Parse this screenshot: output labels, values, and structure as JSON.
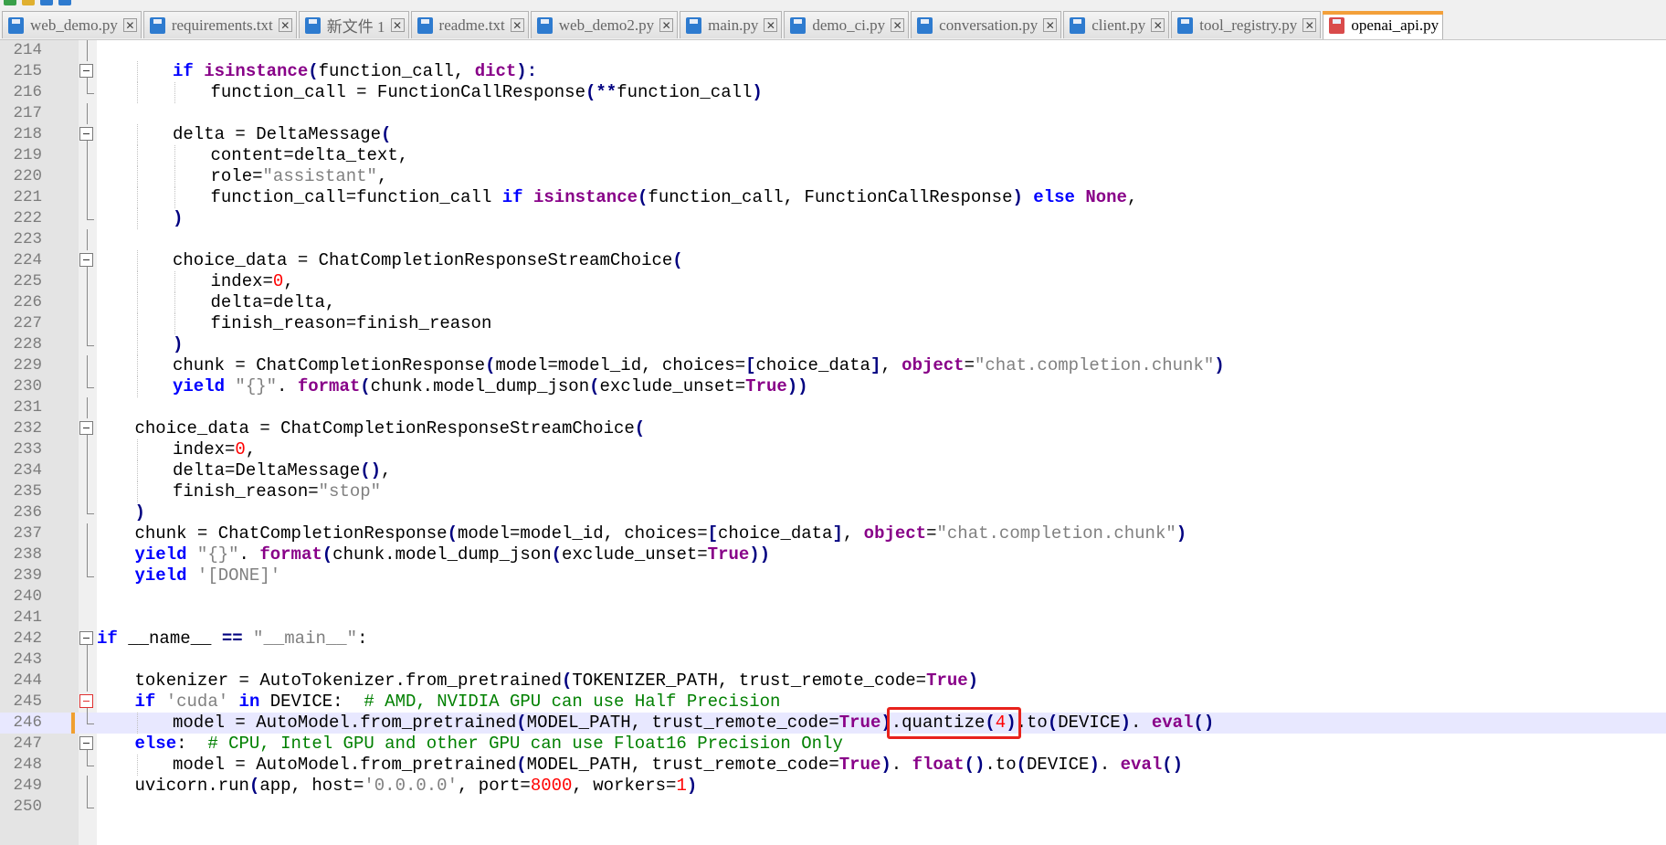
{
  "tabs": [
    {
      "label": "web_demo.py",
      "active": false,
      "unsaved": false
    },
    {
      "label": "requirements.txt",
      "active": false,
      "unsaved": false
    },
    {
      "label": "新文件 1",
      "active": false,
      "unsaved": false
    },
    {
      "label": "readme.txt",
      "active": false,
      "unsaved": false
    },
    {
      "label": "web_demo2.py",
      "active": false,
      "unsaved": false
    },
    {
      "label": "main.py",
      "active": false,
      "unsaved": false
    },
    {
      "label": "demo_ci.py",
      "active": false,
      "unsaved": false
    },
    {
      "label": "conversation.py",
      "active": false,
      "unsaved": false
    },
    {
      "label": "client.py",
      "active": false,
      "unsaved": false
    },
    {
      "label": "tool_registry.py",
      "active": false,
      "unsaved": false
    },
    {
      "label": "openai_api.py",
      "active": true,
      "unsaved": true
    }
  ],
  "tab_close_glyph": "✕",
  "colors": {
    "keyword": "#0000ff",
    "builtin": "#880088",
    "string": "#808080",
    "number": "#ff0000",
    "comment": "#008000",
    "current_line": "#e8e8ff",
    "highlight_box": "#e8221c",
    "active_tab_accent": "#f3a03a"
  },
  "editor": {
    "current_line": 246,
    "highlight": {
      "line": 246,
      "text": ".quantize(4)"
    },
    "lines": [
      {
        "n": 214,
        "indent": 0,
        "fold": "line",
        "tokens": []
      },
      {
        "n": 215,
        "indent": 2,
        "fold": "box",
        "tokens": [
          [
            "kw",
            "if "
          ],
          [
            "bi",
            "isinstance"
          ],
          [
            "op",
            "("
          ],
          [
            "",
            "function_call, "
          ],
          [
            "bi",
            "dict"
          ],
          [
            "op",
            "):"
          ]
        ]
      },
      {
        "n": 216,
        "indent": 3,
        "fold": "end",
        "tokens": [
          [
            "",
            "function_call = FunctionCallResponse"
          ],
          [
            "op",
            "(**"
          ],
          [
            "",
            "function_call"
          ],
          [
            "op",
            ")"
          ]
        ]
      },
      {
        "n": 217,
        "indent": 0,
        "fold": "line",
        "tokens": []
      },
      {
        "n": 218,
        "indent": 2,
        "fold": "box",
        "tokens": [
          [
            "",
            "delta = DeltaMessage"
          ],
          [
            "op",
            "("
          ]
        ]
      },
      {
        "n": 219,
        "indent": 3,
        "fold": "line",
        "tokens": [
          [
            "",
            "content=delta_text,"
          ]
        ]
      },
      {
        "n": 220,
        "indent": 3,
        "fold": "line",
        "tokens": [
          [
            "",
            "role="
          ],
          [
            "st",
            "\"assistant\""
          ],
          [
            "",
            ","
          ]
        ]
      },
      {
        "n": 221,
        "indent": 3,
        "fold": "line",
        "tokens": [
          [
            "",
            "function_call=function_call "
          ],
          [
            "kw",
            "if "
          ],
          [
            "bi",
            "isinstance"
          ],
          [
            "op",
            "("
          ],
          [
            "",
            "function_call, FunctionCallResponse"
          ],
          [
            "op",
            ")"
          ],
          [
            "kw",
            " else "
          ],
          [
            "bi",
            "None"
          ],
          [
            "",
            ","
          ]
        ]
      },
      {
        "n": 222,
        "indent": 2,
        "fold": "end",
        "tokens": [
          [
            "op",
            ")"
          ]
        ]
      },
      {
        "n": 223,
        "indent": 0,
        "fold": "line",
        "tokens": []
      },
      {
        "n": 224,
        "indent": 2,
        "fold": "box",
        "tokens": [
          [
            "",
            "choice_data = ChatCompletionResponseStreamChoice"
          ],
          [
            "op",
            "("
          ]
        ]
      },
      {
        "n": 225,
        "indent": 3,
        "fold": "line",
        "tokens": [
          [
            "",
            "index="
          ],
          [
            "nu",
            "0"
          ],
          [
            "",
            ","
          ]
        ]
      },
      {
        "n": 226,
        "indent": 3,
        "fold": "line",
        "tokens": [
          [
            "",
            "delta=delta,"
          ]
        ]
      },
      {
        "n": 227,
        "indent": 3,
        "fold": "line",
        "tokens": [
          [
            "",
            "finish_reason=finish_reason"
          ]
        ]
      },
      {
        "n": 228,
        "indent": 2,
        "fold": "end",
        "tokens": [
          [
            "op",
            ")"
          ]
        ]
      },
      {
        "n": 229,
        "indent": 2,
        "fold": "line",
        "tokens": [
          [
            "",
            "chunk = ChatCompletionResponse"
          ],
          [
            "op",
            "("
          ],
          [
            "",
            "model=model_id, choices="
          ],
          [
            "op",
            "["
          ],
          [
            "",
            "choice_data"
          ],
          [
            "op",
            "]"
          ],
          [
            "",
            ", "
          ],
          [
            "bi",
            "object"
          ],
          [
            "",
            "="
          ],
          [
            "st",
            "\"chat.completion.chunk\""
          ],
          [
            "op",
            ")"
          ]
        ]
      },
      {
        "n": 230,
        "indent": 2,
        "fold": "end",
        "tokens": [
          [
            "kw",
            "yield "
          ],
          [
            "st",
            "\"{}\""
          ],
          [
            "",
            ". "
          ],
          [
            "bi",
            "format"
          ],
          [
            "op",
            "("
          ],
          [
            "",
            "chunk.model_dump_json"
          ],
          [
            "op",
            "("
          ],
          [
            "",
            "exclude_unset="
          ],
          [
            "bi",
            "True"
          ],
          [
            "op",
            "))"
          ]
        ]
      },
      {
        "n": 231,
        "indent": 0,
        "fold": "line",
        "tokens": []
      },
      {
        "n": 232,
        "indent": 1,
        "fold": "box",
        "tokens": [
          [
            "",
            "choice_data = ChatCompletionResponseStreamChoice"
          ],
          [
            "op",
            "("
          ]
        ]
      },
      {
        "n": 233,
        "indent": 2,
        "fold": "line",
        "tokens": [
          [
            "",
            "index="
          ],
          [
            "nu",
            "0"
          ],
          [
            "",
            ","
          ]
        ]
      },
      {
        "n": 234,
        "indent": 2,
        "fold": "line",
        "tokens": [
          [
            "",
            "delta=DeltaMessage"
          ],
          [
            "op",
            "()"
          ],
          [
            "",
            ","
          ]
        ]
      },
      {
        "n": 235,
        "indent": 2,
        "fold": "line",
        "tokens": [
          [
            "",
            "finish_reason="
          ],
          [
            "st",
            "\"stop\""
          ]
        ]
      },
      {
        "n": 236,
        "indent": 1,
        "fold": "end",
        "tokens": [
          [
            "op",
            ")"
          ]
        ]
      },
      {
        "n": 237,
        "indent": 1,
        "fold": "line",
        "tokens": [
          [
            "",
            "chunk = ChatCompletionResponse"
          ],
          [
            "op",
            "("
          ],
          [
            "",
            "model=model_id, choices="
          ],
          [
            "op",
            "["
          ],
          [
            "",
            "choice_data"
          ],
          [
            "op",
            "]"
          ],
          [
            "",
            ", "
          ],
          [
            "bi",
            "object"
          ],
          [
            "",
            "="
          ],
          [
            "st",
            "\"chat.completion.chunk\""
          ],
          [
            "op",
            ")"
          ]
        ]
      },
      {
        "n": 238,
        "indent": 1,
        "fold": "line",
        "tokens": [
          [
            "kw",
            "yield "
          ],
          [
            "st",
            "\"{}\""
          ],
          [
            "",
            ". "
          ],
          [
            "bi",
            "format"
          ],
          [
            "op",
            "("
          ],
          [
            "",
            "chunk.model_dump_json"
          ],
          [
            "op",
            "("
          ],
          [
            "",
            "exclude_unset="
          ],
          [
            "bi",
            "True"
          ],
          [
            "op",
            "))"
          ]
        ]
      },
      {
        "n": 239,
        "indent": 1,
        "fold": "end",
        "tokens": [
          [
            "kw",
            "yield "
          ],
          [
            "st",
            "'[DONE]'"
          ]
        ]
      },
      {
        "n": 240,
        "indent": 0,
        "fold": "none",
        "tokens": []
      },
      {
        "n": 241,
        "indent": 0,
        "fold": "none",
        "tokens": []
      },
      {
        "n": 242,
        "indent": 0,
        "fold": "box",
        "tokens": [
          [
            "kw",
            "if "
          ],
          [
            "",
            "__name__ "
          ],
          [
            "op",
            "=="
          ],
          [
            "st",
            " \"__main__\""
          ],
          [
            "",
            ":"
          ]
        ]
      },
      {
        "n": 243,
        "indent": 0,
        "fold": "line",
        "tokens": []
      },
      {
        "n": 244,
        "indent": 1,
        "fold": "line",
        "tokens": [
          [
            "",
            "tokenizer = AutoTokenizer.from_pretrained"
          ],
          [
            "op",
            "("
          ],
          [
            "",
            "TOKENIZER_PATH, trust_remote_code="
          ],
          [
            "bi",
            "True"
          ],
          [
            "op",
            ")"
          ]
        ]
      },
      {
        "n": 245,
        "indent": 1,
        "fold": "box-red",
        "tokens": [
          [
            "kw",
            "if "
          ],
          [
            "st",
            "'cuda'"
          ],
          [
            "kw",
            " in "
          ],
          [
            "",
            "DEVICE:  "
          ],
          [
            "cm",
            "# AMD, NVIDIA GPU can use Half Precision"
          ]
        ]
      },
      {
        "n": 246,
        "indent": 2,
        "fold": "end",
        "tokens": [
          [
            "",
            "model = AutoModel.from_pretrained"
          ],
          [
            "op",
            "("
          ],
          [
            "",
            "MODEL_PATH, trust_remote_code="
          ],
          [
            "bi",
            "True"
          ],
          [
            "op",
            ")"
          ],
          [
            "",
            ".quantize"
          ],
          [
            "op",
            "("
          ],
          [
            "nu",
            "4"
          ],
          [
            "op",
            ")"
          ],
          [
            "",
            ".to"
          ],
          [
            "op",
            "("
          ],
          [
            "",
            "DEVICE"
          ],
          [
            "op",
            ")"
          ],
          [
            "",
            ". "
          ],
          [
            "bi",
            "eval"
          ],
          [
            "op",
            "()"
          ]
        ]
      },
      {
        "n": 247,
        "indent": 1,
        "fold": "box",
        "tokens": [
          [
            "kw",
            "else"
          ],
          [
            "",
            ":  "
          ],
          [
            "cm",
            "# CPU, Intel GPU and other GPU can use Float16 Precision Only"
          ]
        ]
      },
      {
        "n": 248,
        "indent": 2,
        "fold": "end",
        "tokens": [
          [
            "",
            "model = AutoModel.from_pretrained"
          ],
          [
            "op",
            "("
          ],
          [
            "",
            "MODEL_PATH, trust_remote_code="
          ],
          [
            "bi",
            "True"
          ],
          [
            "op",
            ")"
          ],
          [
            "",
            ". "
          ],
          [
            "bi",
            "float"
          ],
          [
            "op",
            "()"
          ],
          [
            "",
            ".to"
          ],
          [
            "op",
            "("
          ],
          [
            "",
            "DEVICE"
          ],
          [
            "op",
            ")"
          ],
          [
            "",
            ". "
          ],
          [
            "bi",
            "eval"
          ],
          [
            "op",
            "()"
          ]
        ]
      },
      {
        "n": 249,
        "indent": 1,
        "fold": "line",
        "tokens": [
          [
            "",
            "uvicorn.run"
          ],
          [
            "op",
            "("
          ],
          [
            "",
            "app, host="
          ],
          [
            "st",
            "'0.0.0.0'"
          ],
          [
            "",
            ", port="
          ],
          [
            "nu",
            "8000"
          ],
          [
            "",
            ", workers="
          ],
          [
            "nu",
            "1"
          ],
          [
            "op",
            ")"
          ]
        ]
      },
      {
        "n": 250,
        "indent": 0,
        "fold": "end",
        "tokens": []
      }
    ]
  }
}
